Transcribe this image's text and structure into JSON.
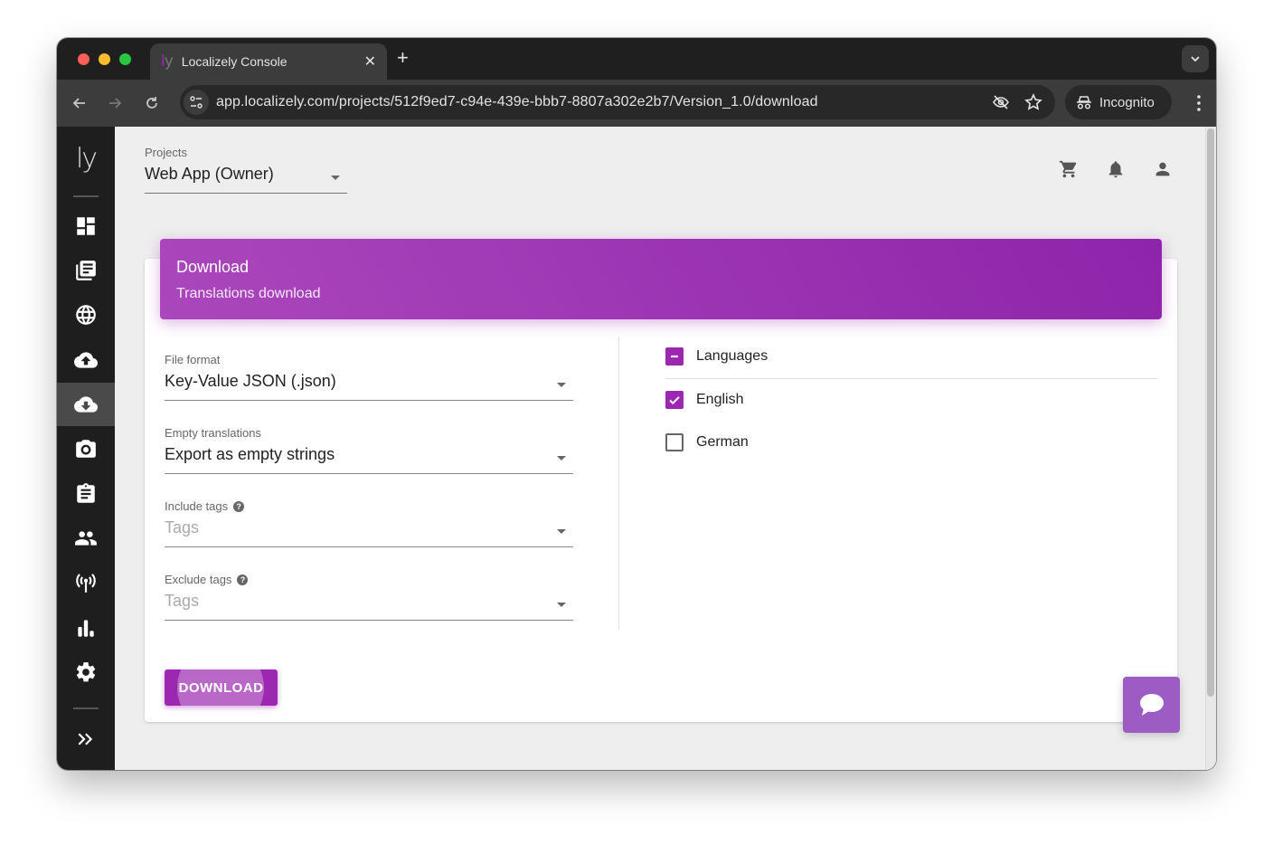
{
  "browser": {
    "tab": {
      "favicon": "ly",
      "title": "Localizely Console"
    },
    "url": "app.localizely.com/projects/512f9ed7-c94e-439e-bbb7-8807a302e2b7/Version_1.0/download",
    "incognito_label": "Incognito"
  },
  "sidebar": {
    "logo": "ly",
    "items": [
      {
        "name": "dashboard",
        "icon": "dashboard-icon",
        "active": false
      },
      {
        "name": "translations",
        "icon": "library-books-icon",
        "active": false
      },
      {
        "name": "languages",
        "icon": "globe-icon",
        "active": false
      },
      {
        "name": "upload",
        "icon": "cloud-upload-icon",
        "active": false
      },
      {
        "name": "download",
        "icon": "cloud-download-icon",
        "active": true
      },
      {
        "name": "screenshots",
        "icon": "camera-icon",
        "active": false
      },
      {
        "name": "tasks",
        "icon": "clipboard-icon",
        "active": false
      },
      {
        "name": "team",
        "icon": "people-icon",
        "active": false
      },
      {
        "name": "integrations",
        "icon": "antenna-icon",
        "active": false
      },
      {
        "name": "reports",
        "icon": "bar-chart-icon",
        "active": false
      },
      {
        "name": "settings",
        "icon": "gear-icon",
        "active": false
      }
    ],
    "expand_icon": "double-chevron-right-icon"
  },
  "header": {
    "projects_label": "Projects",
    "project_value": "Web App (Owner)",
    "icons": [
      "cart-icon",
      "bell-icon",
      "account-icon"
    ]
  },
  "card": {
    "title": "Download",
    "subtitle": "Translations download",
    "fields": {
      "file_format": {
        "label": "File format",
        "value": "Key-Value JSON (.json)"
      },
      "empty_translations": {
        "label": "Empty translations",
        "value": "Export as empty strings"
      },
      "include_tags": {
        "label": "Include tags",
        "placeholder": "Tags"
      },
      "exclude_tags": {
        "label": "Exclude tags",
        "placeholder": "Tags"
      }
    },
    "languages": {
      "header": {
        "label": "Languages",
        "state": "indeterminate"
      },
      "items": [
        {
          "label": "English",
          "checked": true
        },
        {
          "label": "German",
          "checked": false
        }
      ]
    },
    "download_button": "DOWNLOAD"
  },
  "colors": {
    "accent": "#9c27b0",
    "sidebar_bg": "#1e1e1e",
    "chat": "#9c5cc4"
  }
}
